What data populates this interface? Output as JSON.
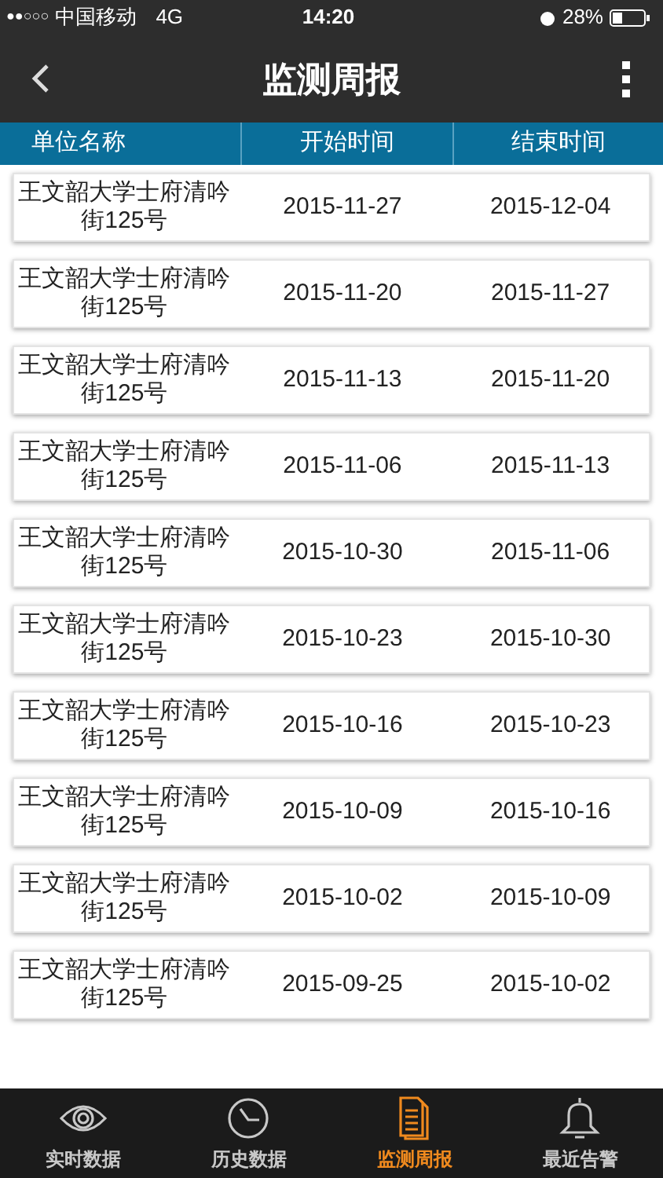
{
  "status_bar": {
    "signal": "●●○○○",
    "carrier": "中国移动",
    "network": "4G",
    "time": "14:20",
    "battery": "28%"
  },
  "nav": {
    "title": "监测周报"
  },
  "table": {
    "columns": [
      "单位名称",
      "开始时间",
      "结束时间"
    ],
    "rows": [
      {
        "name": "王文韶大学士府清吟街125号",
        "start": "2015-11-27",
        "end": "2015-12-04"
      },
      {
        "name": "王文韶大学士府清吟街125号",
        "start": "2015-11-20",
        "end": "2015-11-27"
      },
      {
        "name": "王文韶大学士府清吟街125号",
        "start": "2015-11-13",
        "end": "2015-11-20"
      },
      {
        "name": "王文韶大学士府清吟街125号",
        "start": "2015-11-06",
        "end": "2015-11-13"
      },
      {
        "name": "王文韶大学士府清吟街125号",
        "start": "2015-10-30",
        "end": "2015-11-06"
      },
      {
        "name": "王文韶大学士府清吟街125号",
        "start": "2015-10-23",
        "end": "2015-10-30"
      },
      {
        "name": "王文韶大学士府清吟街125号",
        "start": "2015-10-16",
        "end": "2015-10-23"
      },
      {
        "name": "王文韶大学士府清吟街125号",
        "start": "2015-10-09",
        "end": "2015-10-16"
      },
      {
        "name": "王文韶大学士府清吟街125号",
        "start": "2015-10-02",
        "end": "2015-10-09"
      },
      {
        "name": "王文韶大学士府清吟街125号",
        "start": "2015-09-25",
        "end": "2015-10-02"
      }
    ]
  },
  "tab_bar": [
    {
      "kind": "eye",
      "label": "实时数据",
      "selected": false
    },
    {
      "kind": "clock",
      "label": "历史数据",
      "selected": false
    },
    {
      "kind": "report",
      "label": "监测周报",
      "selected": true
    },
    {
      "kind": "bell",
      "label": "最近告警",
      "selected": false
    }
  ]
}
